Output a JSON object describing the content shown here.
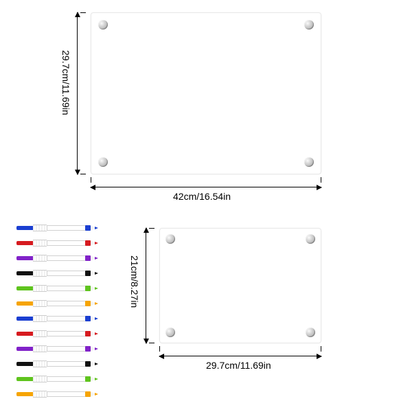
{
  "board_large": {
    "width_label": "42cm/16.54in",
    "height_label": "29.7cm/11.69in"
  },
  "board_small": {
    "width_label": "29.7cm/11.69in",
    "height_label": "21cm/8.27in"
  },
  "markers": [
    {
      "color": "#1b3fd1"
    },
    {
      "color": "#d61a1f"
    },
    {
      "color": "#8122c9"
    },
    {
      "color": "#111111"
    },
    {
      "color": "#5fc41e"
    },
    {
      "color": "#f6a402"
    },
    {
      "color": "#1b3fd1"
    },
    {
      "color": "#d61a1f"
    },
    {
      "color": "#8122c9"
    },
    {
      "color": "#111111"
    },
    {
      "color": "#5fc41e"
    },
    {
      "color": "#f6a402"
    }
  ]
}
